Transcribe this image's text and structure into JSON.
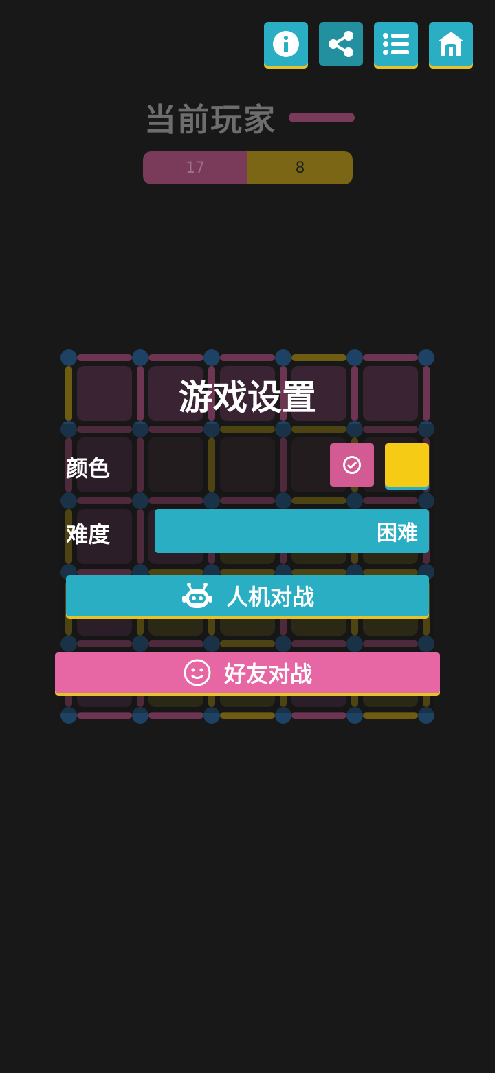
{
  "toolbar": {
    "buttons": [
      {
        "name": "info",
        "icon": "info-icon"
      },
      {
        "name": "share",
        "icon": "share-icon"
      },
      {
        "name": "list",
        "icon": "list-icon"
      },
      {
        "name": "home",
        "icon": "home-icon"
      }
    ]
  },
  "status": {
    "current_player_label": "当前玩家",
    "current_player_color": "#7a3a5a"
  },
  "score": {
    "player1": "17",
    "player2": "8",
    "player1_color": "#7a3a5a",
    "player2_color": "#7a6614"
  },
  "dialog": {
    "title": "游戏设置",
    "color_label": "颜色",
    "color_options": [
      "#d25b94",
      "#f6cb16"
    ],
    "selected_color_index": 0,
    "difficulty_label": "难度",
    "difficulty_value": "困难",
    "ai_button_label": "人机对战",
    "friend_button_label": "好友对战"
  },
  "colors": {
    "accent": "#2aaec4",
    "pink": "#e766a4",
    "yellow": "#f6cb16",
    "background": "#181818"
  }
}
